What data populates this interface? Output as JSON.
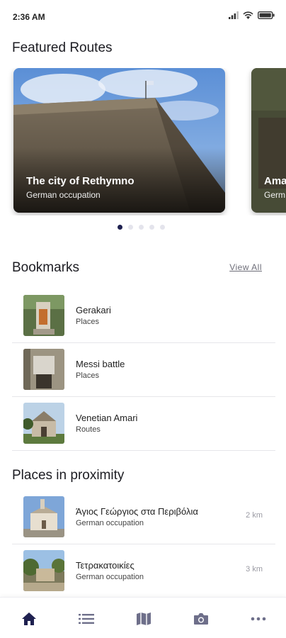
{
  "status": {
    "time": "2:36 AM"
  },
  "featured": {
    "title": "Featured Routes",
    "cards": [
      {
        "title": "The city of Rethymno",
        "subtitle": "German occupation"
      },
      {
        "title": "Ama",
        "subtitle": "Germ"
      }
    ],
    "dots": 5,
    "active_dot": 0
  },
  "bookmarks": {
    "title": "Bookmarks",
    "view_all": "View All",
    "items": [
      {
        "title": "Gerakari",
        "subtitle": "Places"
      },
      {
        "title": "Messi battle",
        "subtitle": "Places"
      },
      {
        "title": "Venetian Amari",
        "subtitle": "Routes"
      }
    ]
  },
  "proximity": {
    "title": "Places in proximity",
    "items": [
      {
        "title": "Άγιος Γεώργιος στα Περιβόλια",
        "subtitle": "German occupation",
        "distance": "2 km"
      },
      {
        "title": "Τετρακατοικίες",
        "subtitle": "German occupation",
        "distance": "3 km"
      }
    ]
  },
  "nav": {
    "items": [
      "home-icon",
      "list-icon",
      "map-icon",
      "camera-icon",
      "more-icon"
    ],
    "active_index": 0,
    "colors": {
      "active": "#1f2150",
      "inactive": "#6e6f8a"
    }
  }
}
